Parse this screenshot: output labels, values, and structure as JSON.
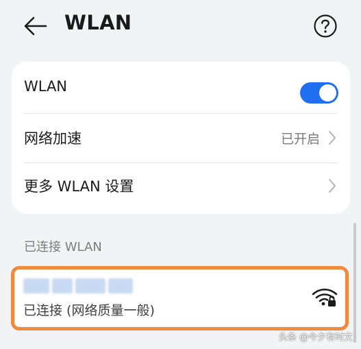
{
  "header": {
    "title": "WLAN",
    "back_icon": "arrow-left-icon",
    "help_icon": "question-circle-icon"
  },
  "settings": {
    "wlan_toggle": {
      "label": "WLAN",
      "enabled": true,
      "accent": "#1f6ff0"
    },
    "network_accel": {
      "label": "网络加速",
      "value": "已开启"
    },
    "more_settings": {
      "label": "更多 WLAN 设置"
    }
  },
  "connected_section": {
    "title": "已连接 WLAN",
    "network": {
      "status": "已连接 (网络质量一般)",
      "icon": "wifi-locked-icon",
      "highlight": "#f08a3c"
    }
  },
  "watermark": "头条 @今夕有时文"
}
